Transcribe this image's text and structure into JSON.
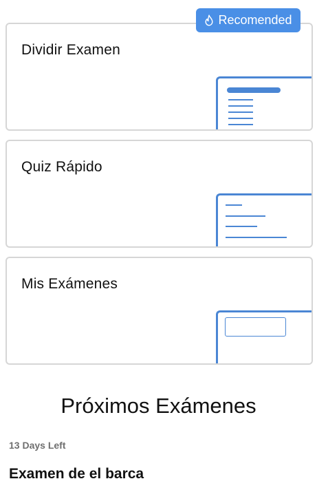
{
  "badge": {
    "label": "Recomended",
    "icon": "flame-icon",
    "color": "#4a8fe6"
  },
  "cards": [
    {
      "title": "Dividir Examen"
    },
    {
      "title": "Quiz Rápido"
    },
    {
      "title": "Mis Exámenes"
    }
  ],
  "accent_color": "#4a86d4",
  "upcoming": {
    "title": "Próximos Exámenes",
    "items": [
      {
        "days_left": "13 Days Left",
        "name": "Examen de el barca"
      }
    ]
  }
}
